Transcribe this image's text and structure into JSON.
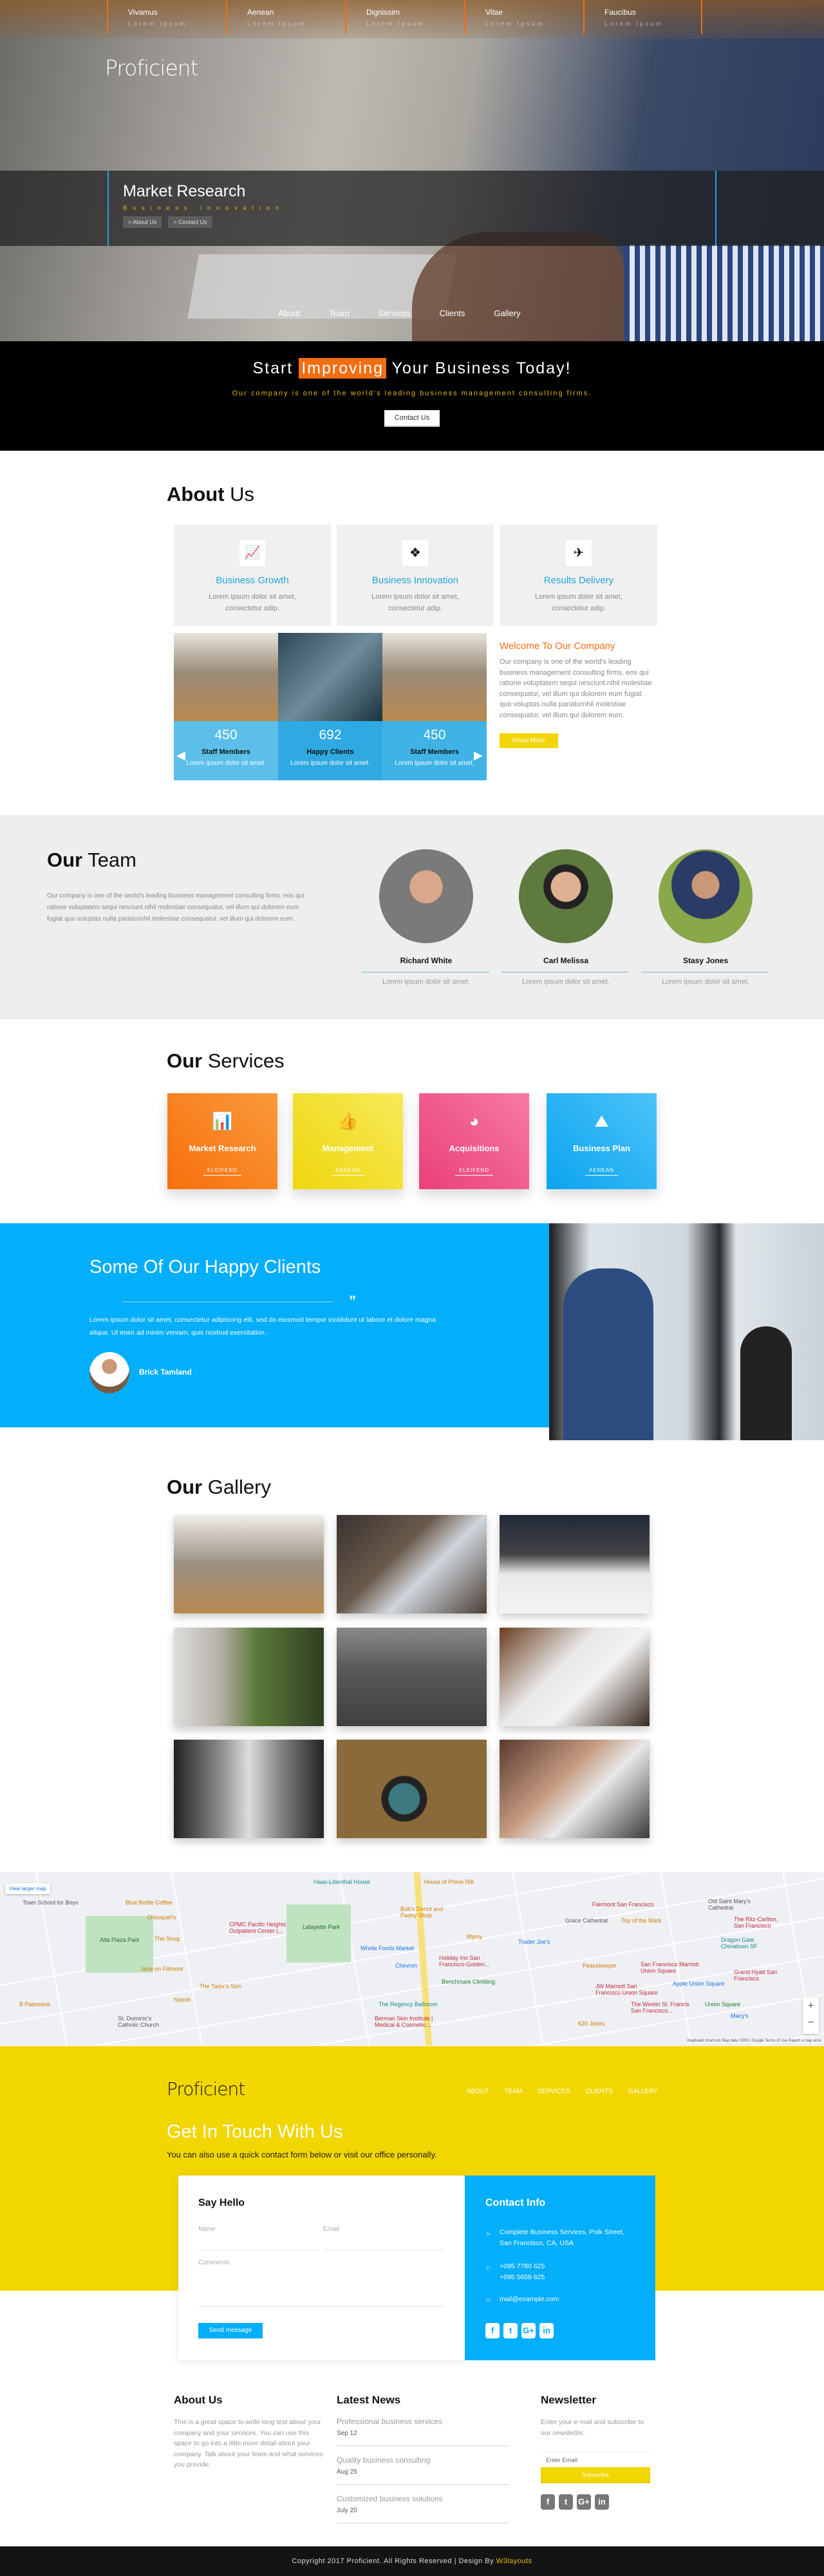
{
  "top_nav": [
    {
      "title": "Vivamus",
      "sub": "Lorem Ipsum"
    },
    {
      "title": "Aenean",
      "sub": "Lorem Ipsum"
    },
    {
      "title": "Dignissim",
      "sub": "Lorem Ipsum"
    },
    {
      "title": "Vitae",
      "sub": "Lorem Ipsum"
    },
    {
      "title": "Faucibus",
      "sub": "Lorem Ipsum"
    }
  ],
  "brand": "Proficient",
  "hero": {
    "title": "Market Research",
    "subtitle": "Business innovation",
    "buttons": [
      "> About Us",
      "> Contact Us"
    ]
  },
  "main_nav": [
    "About",
    "Team",
    "Services",
    "Clients",
    "Gallery"
  ],
  "cta": {
    "pre": "Start",
    "highlight": "Improving",
    "post": "Your Business Today!",
    "text": "Our company is one of the world's leading business management consulting firms.",
    "button": "Contact Us"
  },
  "about": {
    "title_bold": "About",
    "title_light": "Us",
    "features": [
      {
        "icon": "area-chart-icon",
        "glyph": "📈",
        "title": "Business Growth",
        "text1": "Lorem ipsum dolor sit amet,",
        "text2": "consectetur adip."
      },
      {
        "icon": "cubes-icon",
        "glyph": "❖",
        "title": "Business Innovation",
        "text1": "Lorem ipsum dolor sit amet,",
        "text2": "consectetur adip."
      },
      {
        "icon": "paper-plane-icon",
        "glyph": "✈",
        "title": "Results Delivery",
        "text1": "Lorem ipsum dolor sit amet,",
        "text2": "consectetur adip."
      }
    ],
    "stats": [
      {
        "value": "450",
        "label": "Staff Members",
        "text": "Lorem ipsum dolor sit amet."
      },
      {
        "value": "692",
        "label": "Happy Clients",
        "text": "Lorem ipsum dolor sit amet."
      },
      {
        "value": "450",
        "label": "Staff Members",
        "text": "Lorem ipsum dolor sit amet."
      }
    ],
    "welcome_title": "Welcome To Our Company",
    "welcome_text": "Our company is one of the world's leading business management consulting firms. eos qui ratione voluptatem sequi nesciunt.nihil molestiae consequatur, vel illum qui dolorem eum fugiat quo voluptas nulla pariaturnhil molestiae consequatur, vel illum qui dolorem eum.",
    "know_more": "Know More"
  },
  "team": {
    "title_bold": "Our",
    "title_light": "Team",
    "text": "Our company is one of the world's leading business management consulting firms. eos qui ratione voluptatem sequi nesciunt.nihil molestiae consequatur, vel illum qui dolorem eum fugiat quo voluptas nulla pariaturnhil molestiae consequatur, vel illum qui dolorem eum.",
    "members": [
      {
        "name": "Richard White",
        "desc": "Lorem ipsum dolor sit amet."
      },
      {
        "name": "Carl Melissa",
        "desc": "Lorem ipsum dolor sit amet."
      },
      {
        "name": "Stasy Jones",
        "desc": "Lorem ipsum dolor sit amet."
      }
    ]
  },
  "services": {
    "title_bold": "Our",
    "title_light": "Services",
    "items": [
      {
        "icon": "bar-chart-icon",
        "glyph": "📊",
        "title": "Market Research",
        "link": "ELEIFEND",
        "color": "#f7731c"
      },
      {
        "icon": "thumbs-up-icon",
        "glyph": "👍",
        "title": "Management",
        "link": "AENEAN",
        "color": "#f2dc1a"
      },
      {
        "icon": "pie-chart-icon",
        "glyph": "◕",
        "title": "Acquisitions",
        "link": "ELEIFEND",
        "color": "#f0558b"
      },
      {
        "icon": "area-chart-icon",
        "glyph": "⛰",
        "title": "Business Plan",
        "link": "AENEAN",
        "color": "#1eb1f2"
      }
    ]
  },
  "clients": {
    "title_bold": "Some Of Our",
    "title_light": "Happy Clients",
    "quote_mark": "”",
    "text": "Lorem ipsum dolor sit amet, consectetur adipiscing elit, sed do eiusmod tempor incididunt ut labore et dolore magna aliqua. Ut enim ad minim veniam, quis nostrud exercitation .",
    "author": "Brick Tamland"
  },
  "gallery": {
    "title_bold": "Our",
    "title_light": "Gallery"
  },
  "map": {
    "larger_link": "View larger map",
    "places": [
      "Town School for Boys",
      "Blue Bottle Coffee",
      "Chouquet's",
      "Alta Plaza Park",
      "The Snug",
      "CPMC Pacific Heights Outpatient Center |...",
      "Lafayette Park",
      "Haas-Lilienthal House",
      "House of Prime Rib",
      "Bob's Donut and Pastry Shop",
      "Whole Foods Market",
      "Holiday Inn San Francisco-Golden...",
      "Chevron",
      "Mymy",
      "Trader Joe's",
      "Benchmark Climbing",
      "The Regency Ballroom",
      "Berman Skin Institute | Medical & Cosmetic...",
      "Jane on Fillmore",
      "The Tailor's Son",
      "Noosh",
      "B Patisserie",
      "St. Dominic's Catholic Church",
      "Fairmont San Francisco",
      "Grace Cathedral",
      "Top of the Mark",
      "Old Saint Mary's Cathedral",
      "The Ritz-Carlton, San Francisco",
      "Dragon Gate Chinatown SF",
      "Peacekeeper",
      "San Francisco Marriott Union Square",
      "Grand Hyatt San Francisco",
      "JW Marriott San Francisco Union Square",
      "Apple Union Square",
      "The Westin St. Francis San Francisco...",
      "Union Square",
      "Macy's",
      "620 Jones"
    ],
    "attribution": "Keyboard shortcuts   Map data ©2021 Google   Terms of Use   Report a map error"
  },
  "contact": {
    "nav": [
      "ABOUT",
      "TEAM",
      "SERVICES",
      "CLIENTS",
      "GALLERY"
    ],
    "title_bold": "Get In Touch",
    "title_light": "With Us",
    "subtitle": "You can also use a quick contact form below or visit our office personally.",
    "form_title": "Say Hello",
    "name_placeholder": "Name",
    "email_placeholder": "Email",
    "comments_placeholder": "Comments",
    "send": "Send message",
    "info_title": "Contact Info",
    "address1": "Complete Business Services, Polk Street,",
    "address2": "San Francisco, CA, USA",
    "phone1": "+095 7780 625",
    "phone2": "+095 5658 625",
    "email": "mail@example.com"
  },
  "footer": {
    "about_title": "About Us",
    "about_text": "This is a great space to write long text about your company and your services. You can use this space to go into a little more detail about your company. Talk about your team and what services you provide.",
    "news_title": "Latest News",
    "news": [
      {
        "title": "Professional business services",
        "date": "Sep 12"
      },
      {
        "title": "Quality business consulting",
        "date": "Aug 25"
      },
      {
        "title": "Customized business solutions",
        "date": "July 20"
      }
    ],
    "newsletter_title": "Newsletter",
    "newsletter_text": "Enter your e-mail and subscribe to our newsletter.",
    "email_placeholder": "Enter Email",
    "subscribe": "Subscribe",
    "copyright": "Copyright 2017 Proficient. All Rights Reserved | Design By",
    "designer": "W3layouts"
  },
  "colors": {
    "orange": "#f26e12",
    "yellow": "#f2d600",
    "blue": "#03aefa",
    "pink": "#f0558b",
    "gold_text": "#e2b70c"
  }
}
